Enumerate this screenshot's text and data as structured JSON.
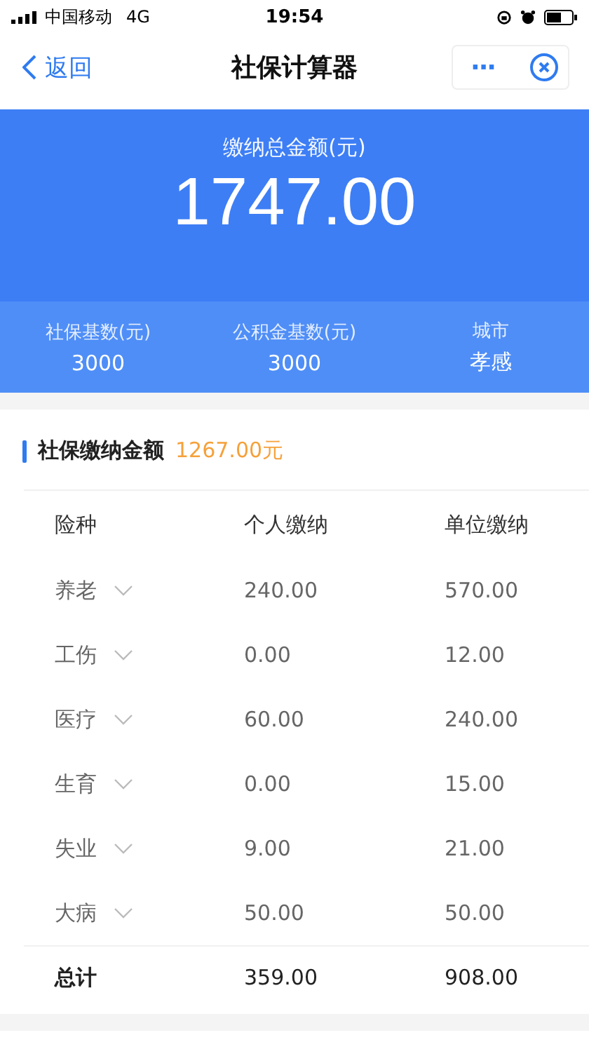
{
  "status_bar": {
    "carrier": "中国移动",
    "network": "4G",
    "time": "19:54"
  },
  "nav": {
    "back": "返回",
    "title": "社保计算器",
    "more": "···"
  },
  "summary": {
    "label": "缴纳总金额(元)",
    "amount": "1747.00"
  },
  "stats": [
    {
      "label": "社保基数(元)",
      "value": "3000"
    },
    {
      "label": "公积金基数(元)",
      "value": "3000"
    },
    {
      "label": "城市",
      "value": "孝感"
    }
  ],
  "section": {
    "title": "社保缴纳金额",
    "amount": "1267.00元"
  },
  "table": {
    "columns": [
      "险种",
      "个人缴纳",
      "单位缴纳"
    ],
    "rows": [
      {
        "name": "养老",
        "personal": "240.00",
        "company": "570.00",
        "expanded": false
      },
      {
        "name": "工伤",
        "personal": "0.00",
        "company": "12.00",
        "expanded": false
      },
      {
        "name": "医疗",
        "personal": "60.00",
        "company": "240.00",
        "expanded": false
      },
      {
        "name": "生育",
        "personal": "0.00",
        "company": "15.00",
        "expanded": false
      },
      {
        "name": "失业",
        "personal": "9.00",
        "company": "21.00",
        "expanded": false
      },
      {
        "name": "大病",
        "personal": "50.00",
        "company": "50.00",
        "expanded": false
      }
    ],
    "total": {
      "label": "总计",
      "personal": "359.00",
      "company": "908.00"
    }
  }
}
